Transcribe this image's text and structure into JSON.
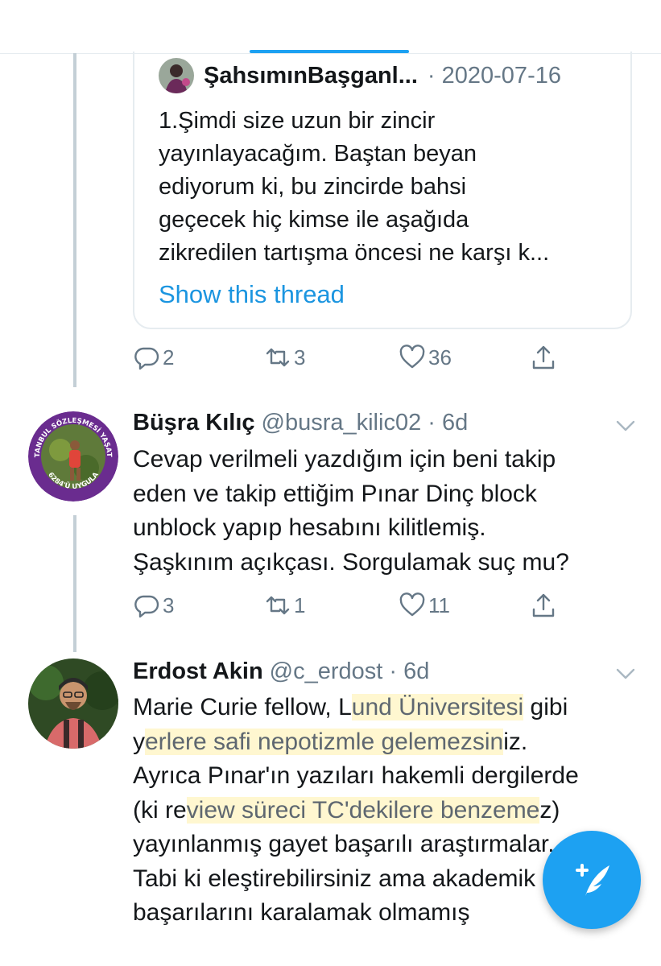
{
  "quoted_tweet": {
    "author": "ŞahsımınBaşganl...",
    "meta": "· 2020-07-16",
    "lines": [
      "1.Şimdi size uzun bir zincir",
      "yayınlayacağım. Baştan beyan",
      "ediyorum ki, bu zincirde bahsi",
      "geçecek hiç kimse ile aşağıda",
      "zikredilen tartışma öncesi ne karşı k..."
    ],
    "show_thread": "Show this thread"
  },
  "actions_1": {
    "replies": "2",
    "retweets": "3",
    "likes": "36"
  },
  "tweet_1": {
    "name": "Büşra Kılıç",
    "meta": "@busra_kilic02 · 6d",
    "lines": [
      "Cevap verilmeli yazdığım için beni takip",
      "eden ve takip ettiğim Pınar Dinç block",
      "unblock yapıp hesabını kilitlemiş.",
      "Şaşkınım açıkçası. Sorgulamak suç mu?"
    ],
    "avatar_ring_text_top": "İSTANBUL SÖZLEŞMESİ YAŞATIR",
    "avatar_ring_text_bottom": "6284'Ü UYGULA"
  },
  "actions_2": {
    "replies": "3",
    "retweets": "1",
    "likes": "11"
  },
  "tweet_2": {
    "name": "Erdost Akin",
    "meta": "@c_erdost · 6d",
    "line1_a": "Marie Curie fellow, L",
    "line1_hl": "und Üniversitesi",
    "line1_b": " gibi",
    "line2_a": "y",
    "line2_hl": "erlere safi nepotizmle gelemezsin",
    "line2_b": "iz.",
    "line3": "Ayrıca Pınar'ın yazıları hakemli dergilerde",
    "line4_a": "(ki re",
    "line4_hl": "view süreci TC'dekilere benzeme",
    "line4_b": "z)",
    "line5": "yayınlanmış gayet başarılı araştırmalar.",
    "line6": "Tabi ki eleştirebilirsiniz ama akademik",
    "line7": "başarılarını karalamak olmamış"
  },
  "icons": {
    "reply": "reply-icon",
    "retweet": "retweet-icon",
    "like": "heart-icon",
    "share": "share-icon",
    "caret": "chevron-down-icon",
    "compose": "compose-tweet-icon"
  },
  "colors": {
    "accent": "#1da1f2",
    "link": "#1b95e0",
    "secondary_text": "#657786",
    "thread_line": "#c4cfd6",
    "avatar_ring": "#6a2c8f"
  }
}
